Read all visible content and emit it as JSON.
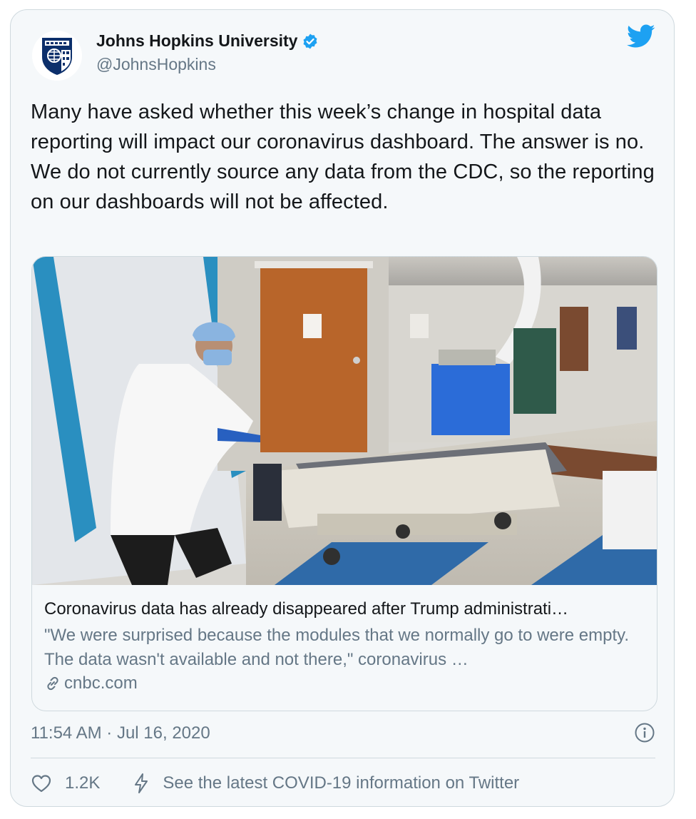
{
  "account": {
    "name": "Johns Hopkins University",
    "handle": "@JohnsHopkins"
  },
  "tweet": {
    "text": "Many have asked whether this week’s change in hospital data reporting will impact our coronavirus dashboard. The answer is no. We do not currently source any data from the CDC, so the reporting on our dashboards will not be affected."
  },
  "link_card": {
    "image_icon": "hospital-photo",
    "title": "Coronavirus data has already disappeared after Trump administrati…",
    "description": "\"We were surprised because the modules that we normally go to were empty. The data wasn't available and not there,\" coronavirus …",
    "domain": "cnbc.com"
  },
  "meta": {
    "timestamp": "11:54 AM · Jul 16, 2020"
  },
  "actions": {
    "like_count": "1.2K",
    "covid_info": "See the latest COVID-19 information on Twitter"
  },
  "colors": {
    "twitter_blue": "#1da1f2",
    "secondary_text": "#657786",
    "border": "#cfd9de",
    "background": "#f5f8fa",
    "jhu_navy": "#0c2f6b"
  },
  "icons": [
    "jhu-shield-icon",
    "verified-badge-icon",
    "twitter-bird-icon",
    "link-icon",
    "info-icon",
    "heart-icon",
    "bolt-icon"
  ]
}
